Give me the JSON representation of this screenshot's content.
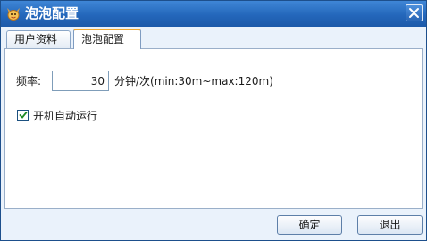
{
  "window": {
    "title": "泡泡配置"
  },
  "tabs": [
    {
      "label": "用户资料",
      "active": false
    },
    {
      "label": "泡泡配置",
      "active": true
    }
  ],
  "settings": {
    "frequency_label": "频率:",
    "frequency_value": "30",
    "frequency_unit": "分钟/次(min:30m~max:120m)",
    "autostart_label": "开机自动运行",
    "autostart_checked": true
  },
  "buttons": {
    "ok": "确定",
    "exit": "退出"
  },
  "colors": {
    "titlebar": "#2467bb",
    "active_tab_accent": "#f0a830",
    "window_bg": "#eaf2fb"
  },
  "icons": {
    "app": "bubble-mascot-icon",
    "close": "close-icon",
    "check": "check-icon"
  }
}
